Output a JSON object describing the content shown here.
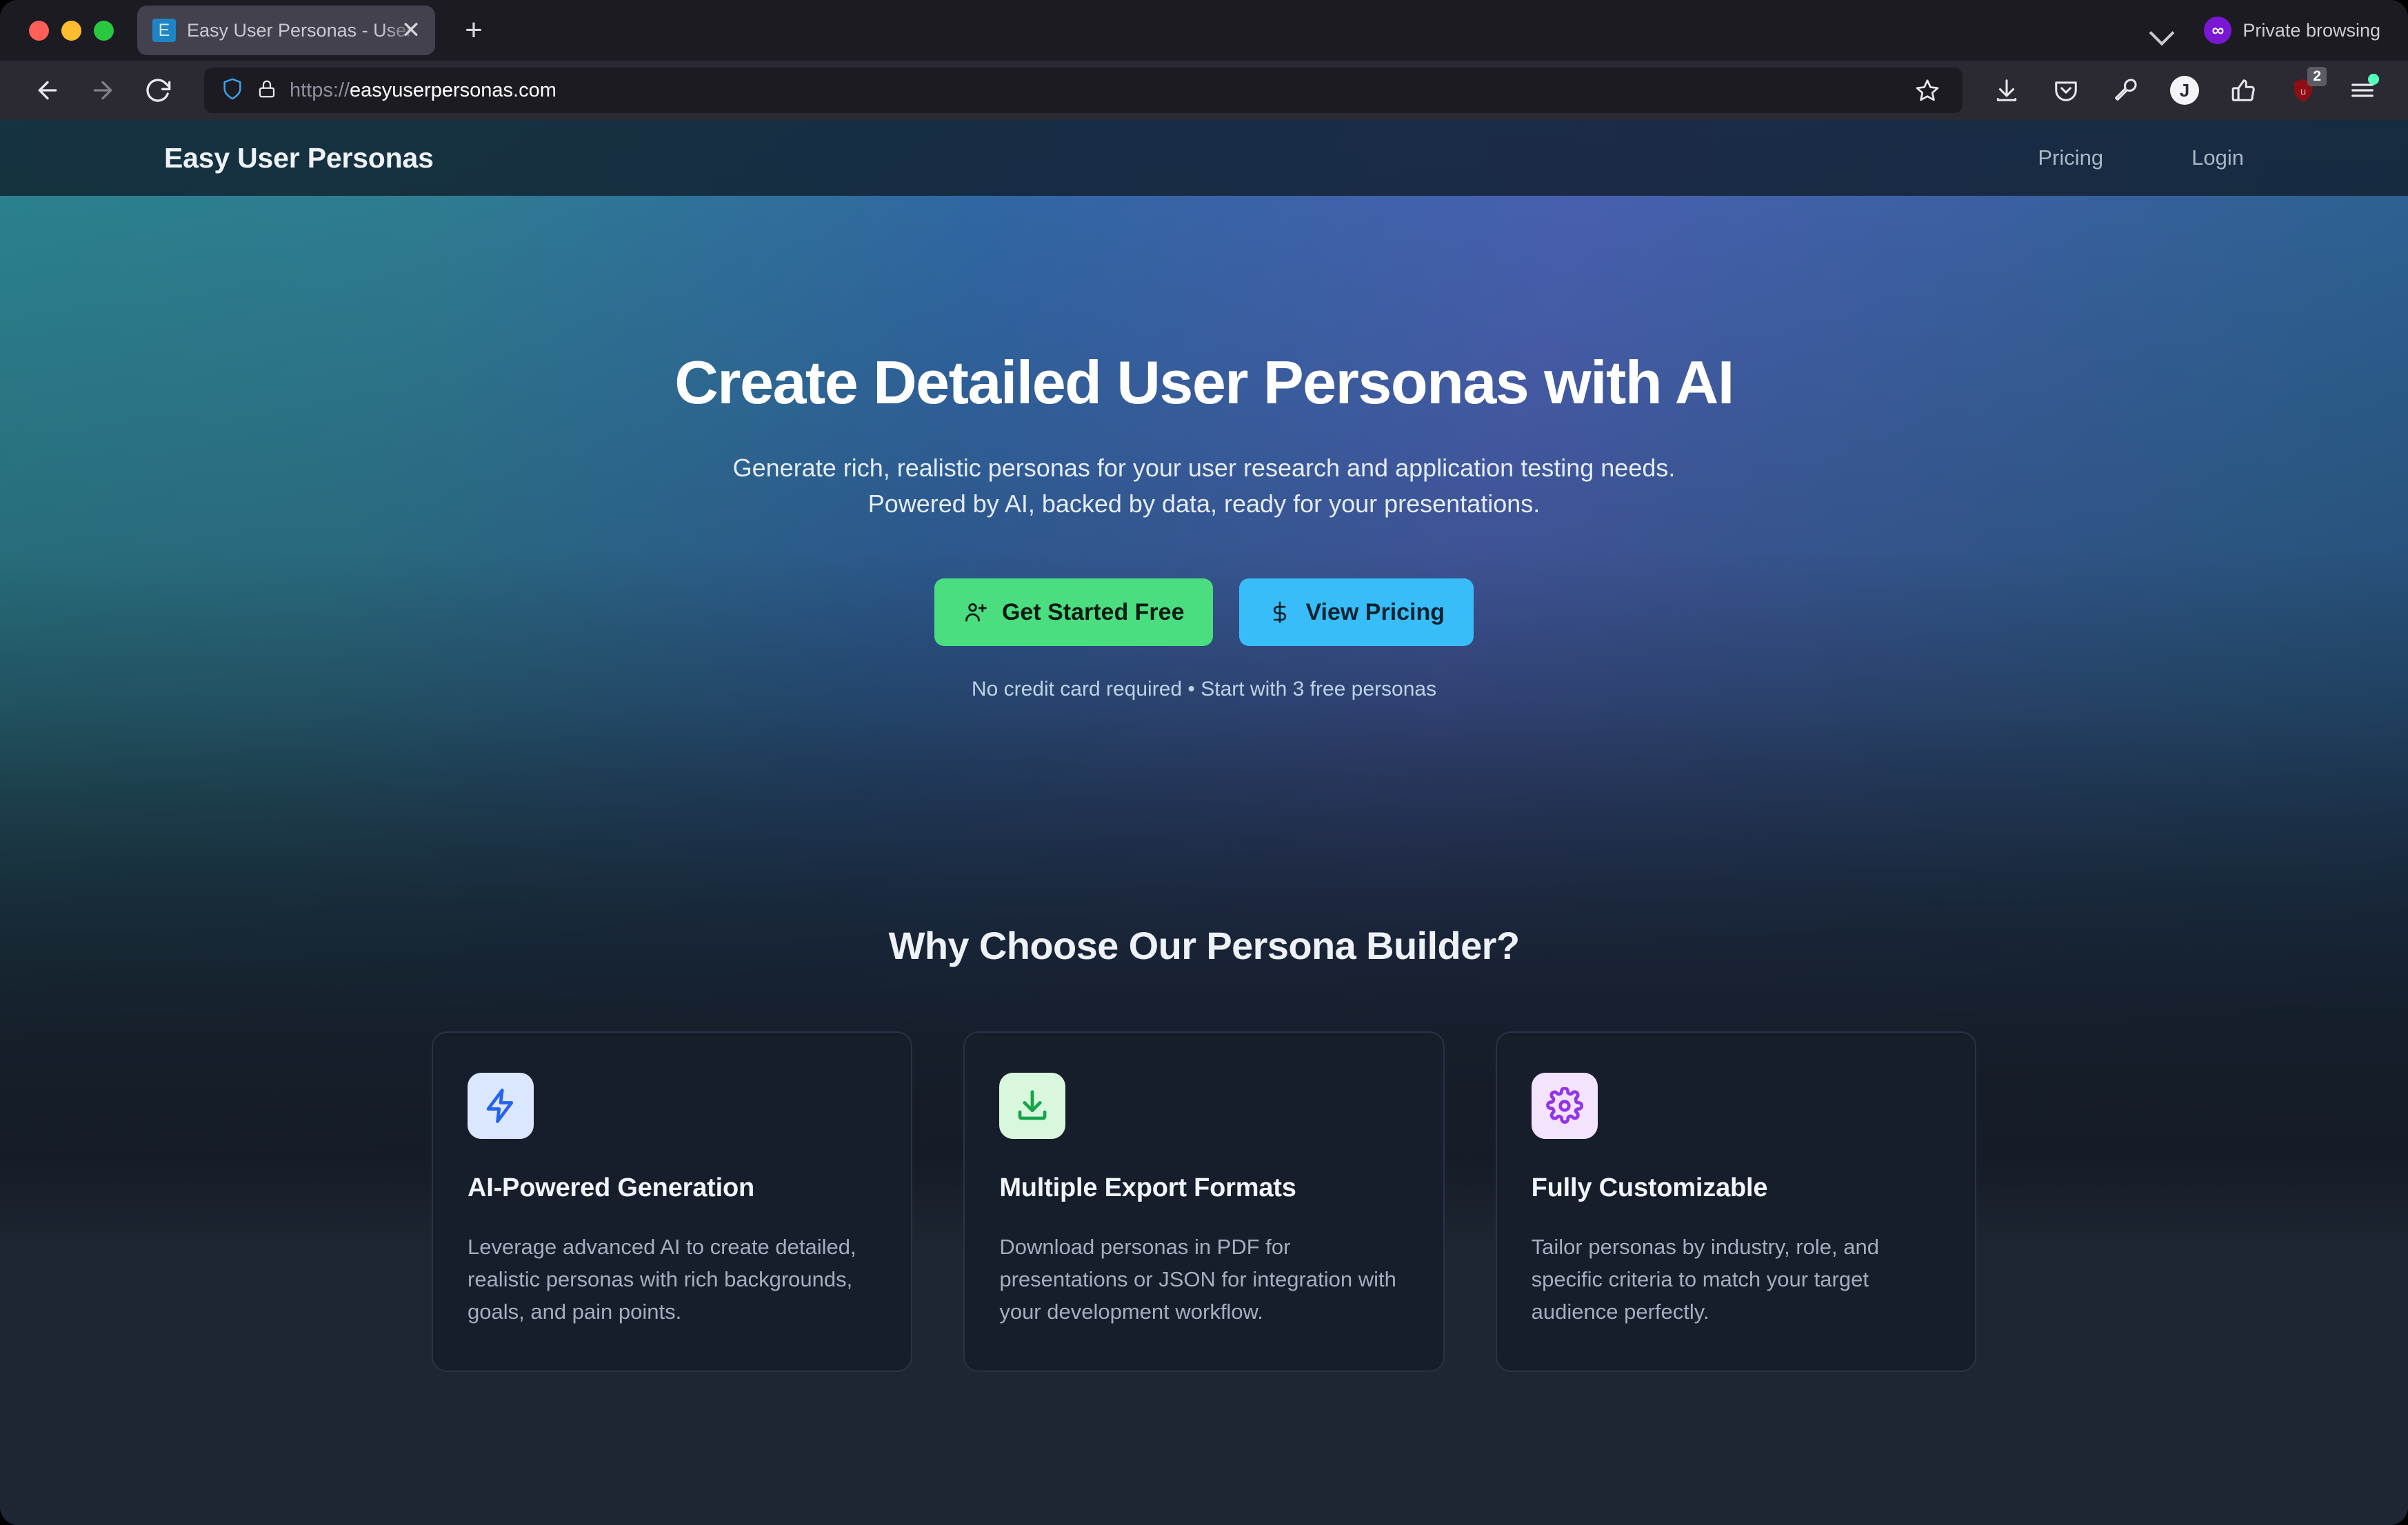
{
  "browser": {
    "tab": {
      "favicon_letter": "E",
      "title": "Easy User Personas - User gene",
      "close_label": "✕"
    },
    "new_tab_label": "+",
    "private_browsing": {
      "icon_glyph": "∞",
      "label": "Private browsing"
    },
    "url": {
      "scheme": "https://",
      "host": "easyuserpersonas.com"
    },
    "extension_badge_count": "2",
    "profile_initial": "J"
  },
  "site": {
    "brand": "Easy User Personas",
    "nav": [
      {
        "label": "Pricing"
      },
      {
        "label": "Login"
      }
    ]
  },
  "hero": {
    "heading": "Create Detailed User Personas with AI",
    "subline_1": "Generate rich, realistic personas for your user research and application testing needs.",
    "subline_2": "Powered by AI, backed by data, ready for your presentations.",
    "primary_cta": "Get Started Free",
    "secondary_cta": "View Pricing",
    "note": "No credit card required • Start with 3 free personas"
  },
  "features": {
    "heading": "Why Choose Our Persona Builder?",
    "cards": [
      {
        "icon": "bolt-icon",
        "icon_bg": "#dbe7fe",
        "icon_color": "#2563eb",
        "title": "AI-Powered Generation",
        "body": "Leverage advanced AI to create detailed, realistic personas with rich backgrounds, goals, and pain points."
      },
      {
        "icon": "download-icon",
        "icon_bg": "#d8f7dd",
        "icon_color": "#16a34a",
        "title": "Multiple Export Formats",
        "body": "Download personas in PDF for presentations or JSON for integration with your development workflow."
      },
      {
        "icon": "gear-icon",
        "icon_bg": "#f3e3fd",
        "icon_color": "#9333ea",
        "title": "Fully Customizable",
        "body": "Tailor personas by industry, role, and specific criteria to match your target audience perfectly."
      }
    ]
  },
  "colors": {
    "accent_green": "#4ade80",
    "accent_blue": "#38bdf8",
    "gradient_start": "#2c8591",
    "gradient_mid": "#4a62b4",
    "page_bg": "#1e2633",
    "card_bg": "#161d2b"
  }
}
